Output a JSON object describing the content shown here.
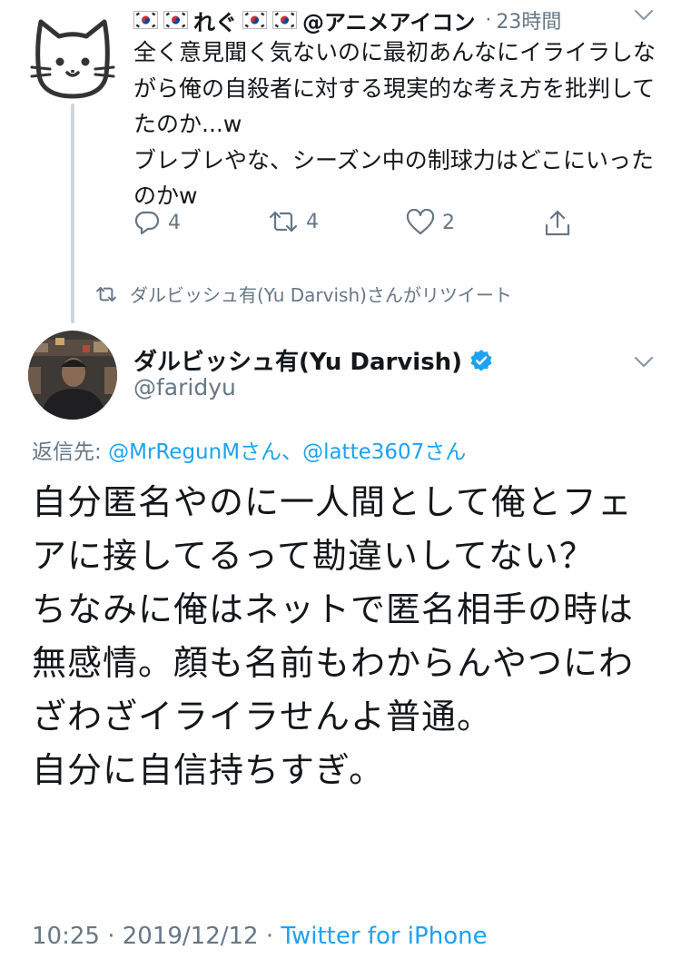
{
  "first_tweet": {
    "display_name": "れぐ",
    "handle_suffix": "@アニメアイコン",
    "separator": "·",
    "time": "23時間",
    "body": "全く意見聞く気ないのに最初あんなにイライラしながら俺の自殺者に対する現実的な考え方を批判してたのか...w\nブレブレやな、シーズン中の制球力はどこにいったのかw",
    "actions": {
      "reply_count": "4",
      "retweet_count": "4",
      "like_count": "2"
    }
  },
  "retweet_notice": "ダルビッシュ有(Yu Darvish)さんがリツイート",
  "main_tweet": {
    "display_name": "ダルビッシュ有(Yu Darvish)",
    "handle": "@faridyu",
    "reply_prefix": "返信先: ",
    "reply_user_1": "@MrRegunMさん",
    "reply_join": "、",
    "reply_user_2": "@latte3607さん",
    "body": "自分匿名やのに一人間として俺とフェアに接してるって勘違いしてない？\nちなみに俺はネットで匿名相手の時は無感情。顔も名前もわからんやつにわざわざイライラせんよ普通。\n自分に自信持ちすぎ。",
    "time": "10:25",
    "dot1": " · ",
    "date": "2019/12/12",
    "dot2": " · ",
    "source": "Twitter for iPhone"
  },
  "icons": [
    "cat-avatar-icon",
    "korea-flag-icon",
    "chevron-down-icon",
    "reply-icon",
    "retweet-icon",
    "like-icon",
    "share-icon",
    "verified-badge-icon"
  ],
  "colors": {
    "link": "#1da1f2",
    "secondary": "#657786",
    "text": "#14171a",
    "line": "#ccd6dd"
  }
}
